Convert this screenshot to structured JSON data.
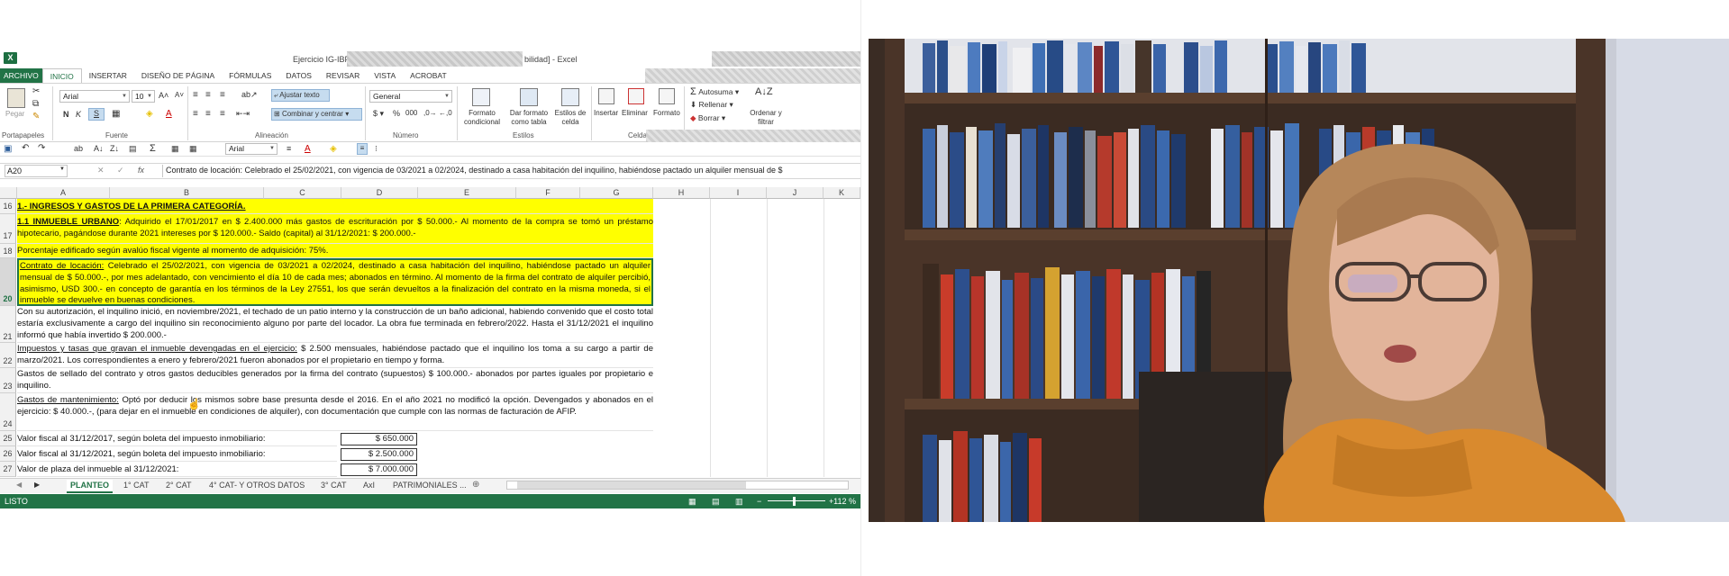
{
  "window": {
    "title_left": "Ejercicio IG-IBP -",
    "title_right": "bilidad] - Excel"
  },
  "ribbon_tabs": [
    "ARCHIVO",
    "INICIO",
    "INSERTAR",
    "DISEÑO DE PÁGINA",
    "FÓRMULAS",
    "DATOS",
    "REVISAR",
    "VISTA",
    "ACROBAT"
  ],
  "ribbon": {
    "paste": "Pegar",
    "font_name": "Arial",
    "font_size": "10",
    "wrap_text": "Ajustar texto",
    "merge_center": "Combinar y centrar",
    "number_format": "General",
    "cond_format": "Formato condicional",
    "format_table": "Dar formato como tabla",
    "cell_styles": "Estilos de celda",
    "insert": "Insertar",
    "delete": "Eliminar",
    "format": "Formato",
    "autosum": "Autosuma",
    "fill": "Rellenar",
    "clear": "Borrar",
    "sort_filter": "Ordenar y filtrar",
    "groups": {
      "clipboard": "Portapapeles",
      "font": "Fuente",
      "alignment": "Alineación",
      "number": "Número",
      "styles": "Estilos",
      "cells": "Celda"
    },
    "qat_font": "Arial"
  },
  "name_box": "A20",
  "formula": "Contrato de locación: Celebrado el 25/02/2021, con vigencia de 03/2021 a 02/2024, destinado a casa habitación del inquilino, habiéndose pactado un alquiler mensual de $",
  "columns": [
    "A",
    "B",
    "C",
    "D",
    "E",
    "F",
    "G",
    "H",
    "I",
    "J",
    "K"
  ],
  "rows": {
    "r16": {
      "num": "16",
      "text": "1.- INGRESOS Y GASTOS DE LA PRIMERA CATEGORÍA."
    },
    "r17": {
      "num": "17",
      "label": "1.1 INMUEBLE URBANO",
      "text": ": Adquirido el 17/01/2017 en $ 2.400.000 más gastos de escrituración por $ 50.000.- Al momento de la compra se tomó un préstamo hipotecario, pagándose durante 2021 intereses por $ 120.000.- Saldo (capital) al 31/12/2021: $ 200.000.-"
    },
    "r18": {
      "num": "18",
      "text": "Porcentaje edificado según avalúo fiscal vigente al momento de adquisición: 75%."
    },
    "r20": {
      "num": "20",
      "label": "Contrato de locación:",
      "text": " Celebrado el 25/02/2021, con vigencia de 03/2021 a 02/2024, destinado a casa habitación del inquilino, habiéndose pactado un alquiler mensual de $ 50.000.-, por mes adelantado, con vencimiento el día 10 de cada mes; abonados en término. Al momento de la firma del contrato de alquiler percibió, asimismo, USD 300.- en concepto de garantía en los términos de la Ley 27551, los que serán devueltos a la finalización del contrato en la misma moneda, si el inmueble se devuelve en buenas condiciones."
    },
    "r21": {
      "num": "21",
      "text": "Con su autorización, el inquilino inició, en noviembre/2021, el techado de un patio interno y la construcción de un baño adicional, habiendo convenido que el costo total estaría exclusivamente a cargo del inquilino sin reconocimiento alguno por parte del locador. La obra fue terminada en febrero/2022. Hasta el 31/12/2021 el inquilino informó que había invertido $ 200.000.-"
    },
    "r22": {
      "num": "22",
      "label": "Impuestos y tasas que gravan el inmueble devengadas en el ejercicio:",
      "text": " $ 2.500 mensuales, habiéndose pactado que el inquilino los toma a su cargo a partir de marzo/2021. Los correspondientes a enero y febrero/2021 fueron abonados por el propietario en tiempo y forma."
    },
    "r23": {
      "num": "23",
      "text": "Gastos de sellado del contrato y otros gastos deducibles generados por la firma del contrato (supuestos) $ 100.000.- abonados por partes iguales por propietario e inquilino."
    },
    "r24": {
      "num": "24",
      "label": "Gastos de mantenimiento:",
      "text": " Optó por deducir los mismos sobre base presunta desde el 2016. En el año 2021 no modificó la opción. Devengados y abonados en el ejercicio: $ 40.000.-, (para dejar en el inmueble en condiciones de alquiler), con documentación que cumple con las normas de facturación de AFIP."
    },
    "r25": {
      "num": "25",
      "text": "Valor fiscal al 31/12/2017, según boleta del impuesto inmobiliario:",
      "value": "$ 650.000"
    },
    "r26": {
      "num": "26",
      "text": "Valor fiscal al 31/12/2021, según boleta del impuesto inmobiliario:",
      "value": "$ 2.500.000"
    },
    "r27": {
      "num": "27",
      "text": "Valor de plaza del inmueble al 31/12/2021:",
      "value": "$ 7.000.000"
    }
  },
  "sheet_tabs": [
    "PLANTEO",
    "1° CAT",
    "2° CAT",
    "4° CAT- Y OTROS DATOS",
    "3° CAT",
    "AxI",
    "PATRIMONIALES ..."
  ],
  "status": {
    "ready": "LISTO",
    "zoom": "112 %"
  },
  "colors": {
    "excel_green": "#217346",
    "highlight_yellow": "#ffff00"
  }
}
